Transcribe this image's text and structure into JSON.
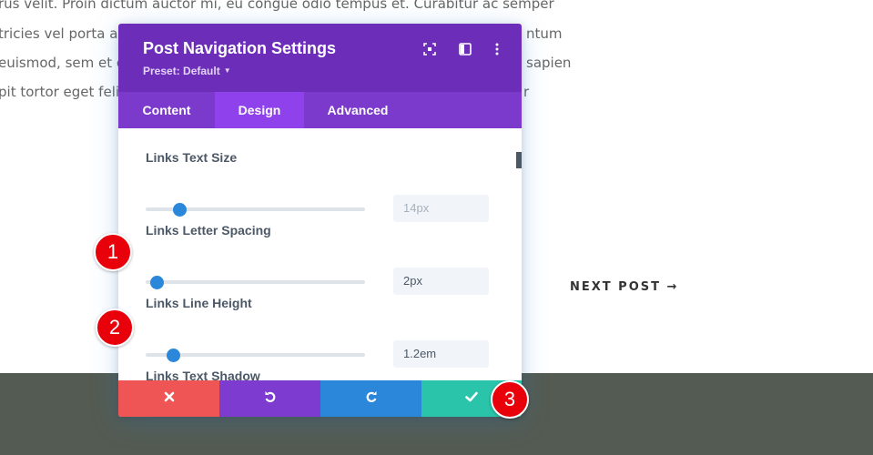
{
  "background": {
    "lines": [
      "rus velit. Proin dictum auctor mi, eu congue odio tempus et. Curabitur ac semper",
      "tricies vel porta ac",
      "euismod, sem et e",
      "pit tortor eget feli"
    ],
    "right_fragments": [
      "ntum",
      "sapien",
      "r"
    ],
    "next_post_label": "NEXT POST →"
  },
  "modal": {
    "title": "Post Navigation Settings",
    "preset_label": "Preset: Default",
    "header_icons": [
      "expand-icon",
      "split-view-icon",
      "more-options-icon"
    ],
    "tabs": [
      {
        "label": "Content",
        "active": false
      },
      {
        "label": "Design",
        "active": true
      },
      {
        "label": "Advanced",
        "active": false
      }
    ],
    "fields": [
      {
        "label": "Links Text Size",
        "value": "14px",
        "placeholder_style": true
      },
      {
        "label": "Links Letter Spacing",
        "value": "2px",
        "placeholder_style": false
      },
      {
        "label": "Links Line Height",
        "value": "1.2em",
        "placeholder_style": false
      },
      {
        "label": "Links Text Shadow"
      }
    ],
    "footer_buttons": [
      "cancel-icon",
      "undo-icon",
      "redo-icon",
      "check-icon"
    ]
  },
  "badges": [
    "1",
    "2",
    "3"
  ],
  "colors": {
    "header_bg": "#6c2eb9",
    "tabs_bg": "#7b3acc",
    "active_tab": "#8f42ec",
    "slider_accent": "#2b87da",
    "cancel": "#ef5555",
    "undo": "#7e3bd0",
    "redo": "#2b87da",
    "save": "#29c4a9",
    "badge": "#e8000b",
    "page_footer": "#545b52"
  }
}
